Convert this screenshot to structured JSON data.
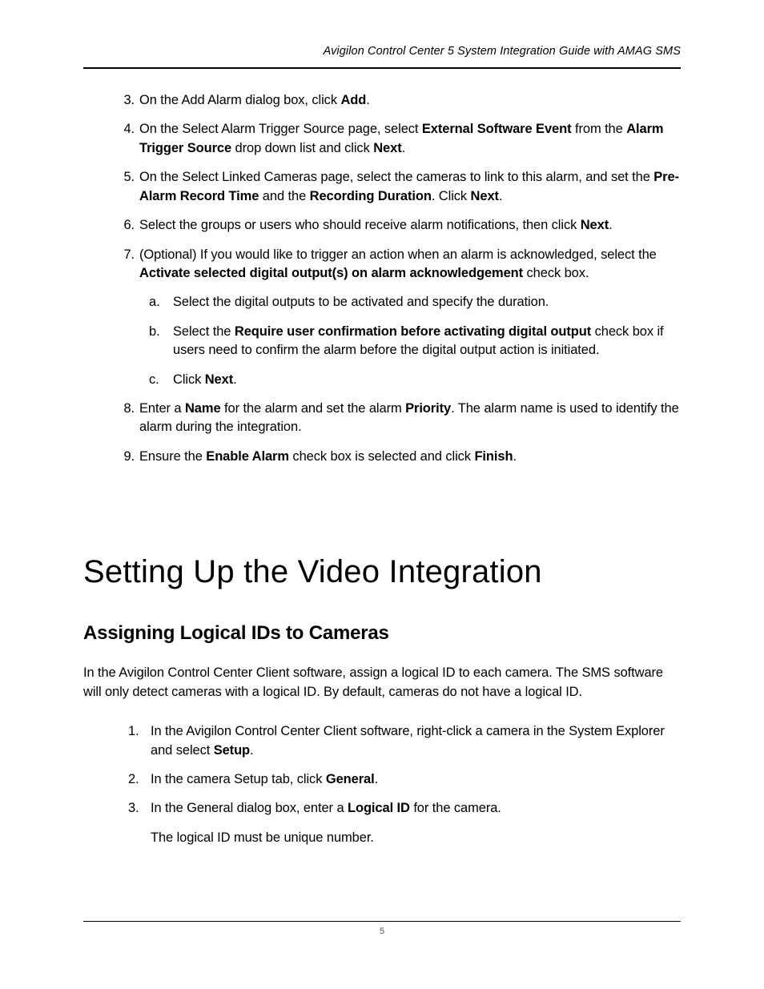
{
  "header": {
    "running_title": "Avigilon Control Center 5 System Integration Guide with AMAG SMS"
  },
  "steps_top": {
    "s3_num": "3.",
    "s3_a": "On the Add Alarm dialog box, click ",
    "s3_b": "Add",
    "s3_c": ".",
    "s4_num": "4.",
    "s4_a": "On the Select Alarm Trigger Source page, select ",
    "s4_b": "External Software Event",
    "s4_c": " from the ",
    "s4_d": "Alarm Trigger Source",
    "s4_e": " drop down list and click ",
    "s4_f": "Next",
    "s4_g": ".",
    "s5_num": "5.",
    "s5_a": "On the Select Linked Cameras page, select the cameras to link to this alarm, and set the ",
    "s5_b": "Pre-Alarm Record Time",
    "s5_c": " and the ",
    "s5_d": "Recording Duration",
    "s5_e": ". Click ",
    "s5_f": "Next",
    "s5_g": ".",
    "s6_num": "6.",
    "s6_a": "Select the groups or users who should receive alarm notifications, then click ",
    "s6_b": "Next",
    "s6_c": ".",
    "s7_num": "7.",
    "s7_a": "(Optional) If you would like to trigger an action when an alarm is acknowledged, select the ",
    "s7_b": "Activate selected digital output(s) on alarm acknowledgement",
    "s7_c": " check box.",
    "s7a_letter": "a.",
    "s7a_text": "Select the digital outputs to be activated and specify the duration.",
    "s7b_letter": "b.",
    "s7b_a": "Select the ",
    "s7b_b": "Require user confirmation before activating digital output",
    "s7b_c": " check box if users need to confirm the alarm before the digital output action is initiated.",
    "s7c_letter": "c.",
    "s7c_a": "Click ",
    "s7c_b": "Next",
    "s7c_c": ".",
    "s8_num": "8.",
    "s8_a": "Enter a ",
    "s8_b": "Name",
    "s8_c": " for the alarm and set the alarm ",
    "s8_d": "Priority",
    "s8_e": ". The alarm name is used to identify the alarm during the integration.",
    "s9_num": "9.",
    "s9_a": "Ensure the ",
    "s9_b": "Enable Alarm",
    "s9_c": " check box is selected and click ",
    "s9_d": "Finish",
    "s9_e": "."
  },
  "section": {
    "title": "Setting Up the Video Integration",
    "subtitle": "Assigning Logical IDs to Cameras",
    "intro": "In the Avigilon Control Center Client software, assign a logical ID to each camera. The SMS software will only detect cameras with a logical ID. By default, cameras do not have a logical ID."
  },
  "steps_bottom": {
    "b1_num": "1.",
    "b1_a": "In the Avigilon Control Center Client software, right-click a camera in the System Explorer and select ",
    "b1_b": "Setup",
    "b1_c": ".",
    "b2_num": "2.",
    "b2_a": "In the camera Setup tab, click ",
    "b2_b": "General",
    "b2_c": ".",
    "b3_num": "3.",
    "b3_a": "In the General dialog box, enter a ",
    "b3_b": "Logical ID",
    "b3_c": " for the camera.",
    "b3_note": "The logical ID must be unique number."
  },
  "footer": {
    "page_number": "5"
  }
}
